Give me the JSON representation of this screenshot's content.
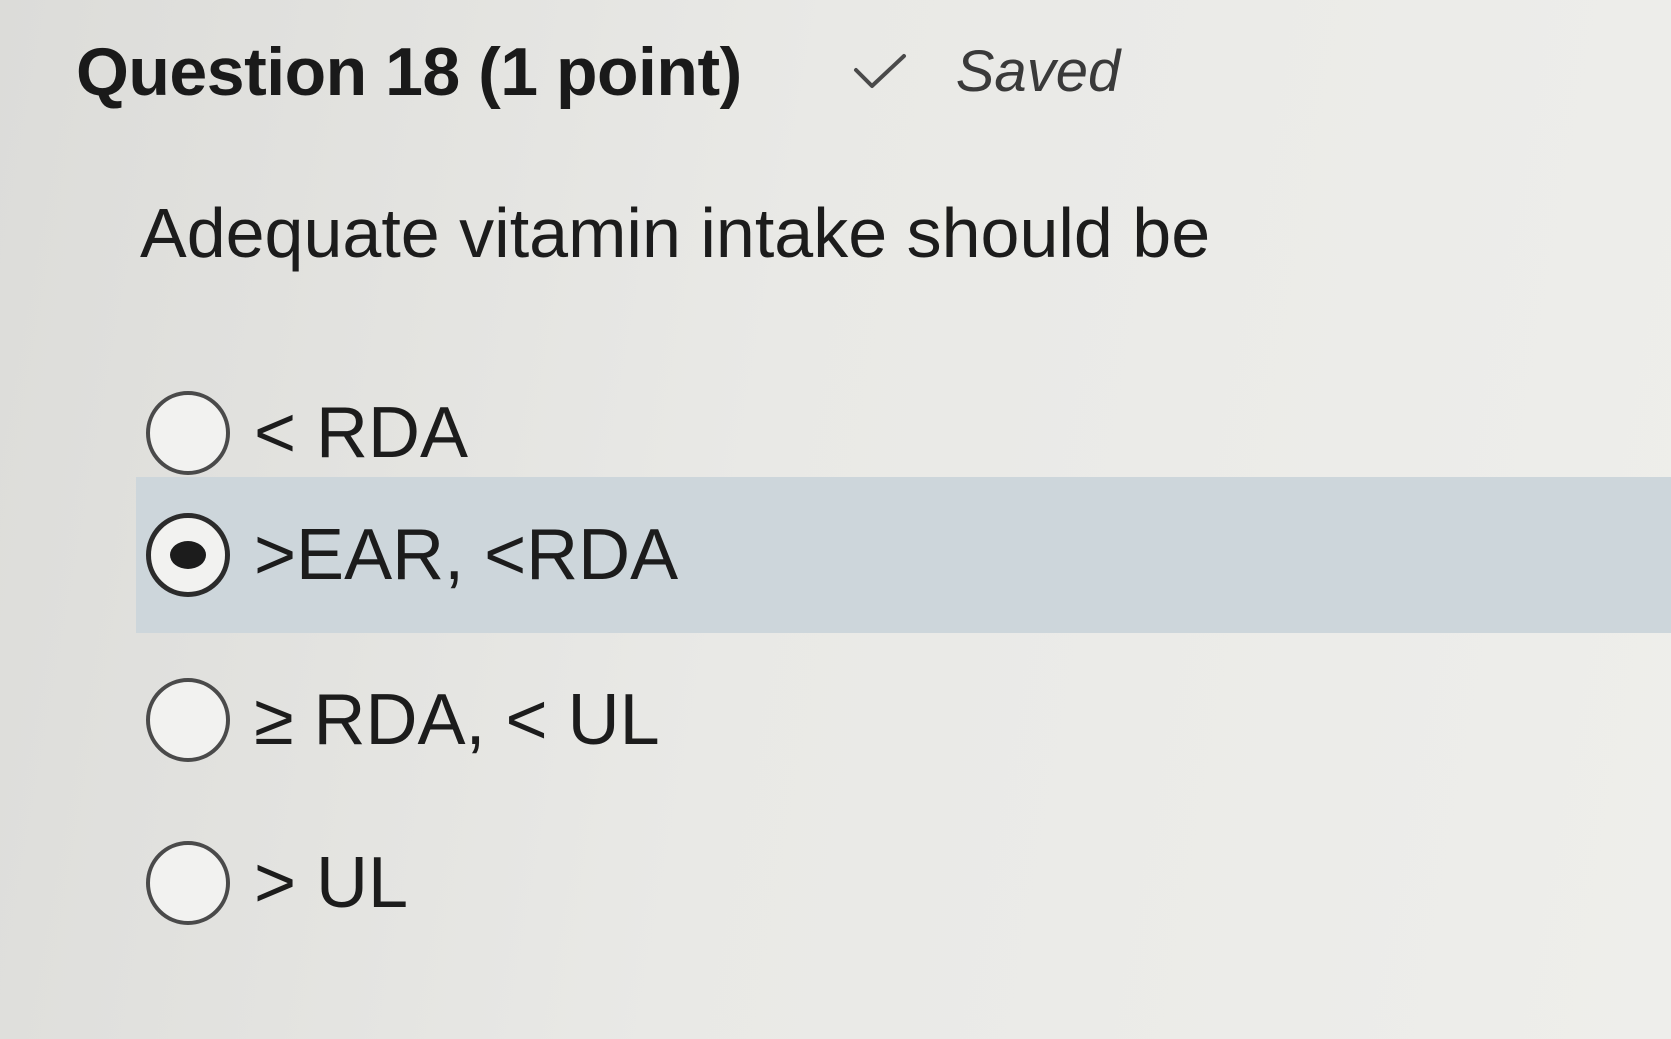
{
  "question": {
    "title": "Question 18 (1 point)",
    "status_icon": "check-icon",
    "status_text": "Saved",
    "prompt": "Adequate vitamin intake should be"
  },
  "options": [
    {
      "label": "< RDA",
      "selected": false
    },
    {
      "label": ">EAR, <RDA",
      "selected": true
    },
    {
      "label": "≥ RDA, < UL",
      "selected": false
    },
    {
      "label": "> UL",
      "selected": false
    }
  ],
  "colors": {
    "selected_row": "#cdd6db",
    "background": "#e9e9e6",
    "text": "#1c1c1c"
  }
}
